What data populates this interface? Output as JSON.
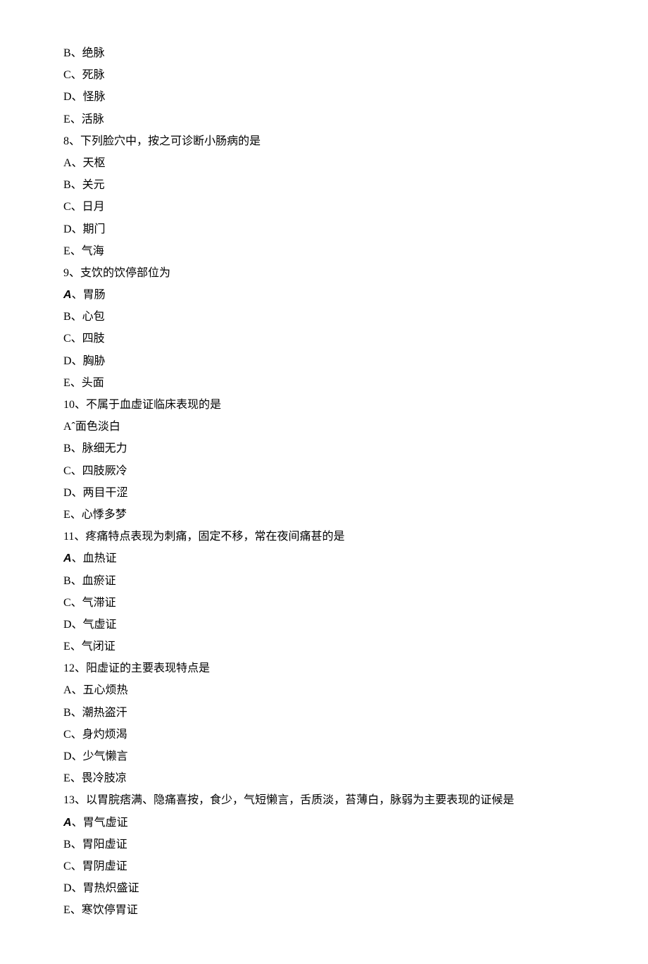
{
  "lines": [
    {
      "text": "B、绝脉",
      "italic": false
    },
    {
      "text": "C、死脉",
      "italic": false
    },
    {
      "text": "D、怪脉",
      "italic": false
    },
    {
      "text": "E、活脉",
      "italic": false
    },
    {
      "text": "8、下列脸穴中，按之可诊断小肠病的是",
      "italic": false
    },
    {
      "text": "A、天枢",
      "italic": false
    },
    {
      "text": "B、关元",
      "italic": false
    },
    {
      "text": "C、日月",
      "italic": false
    },
    {
      "text": "D、期门",
      "italic": false
    },
    {
      "text": "E、气海",
      "italic": false
    },
    {
      "text": "9、支饮的饮停部位为",
      "italic": false
    },
    {
      "prefix": "A",
      "text": "、胃肠",
      "italic": true
    },
    {
      "text": "B、心包",
      "italic": false
    },
    {
      "text": "C、四肢",
      "italic": false
    },
    {
      "text": "D、胸胁",
      "italic": false
    },
    {
      "text": "E、头面",
      "italic": false
    },
    {
      "text": "10、不属于血虚证临床表现的是",
      "italic": false
    },
    {
      "text": "Aˆ面色淡白",
      "italic": false
    },
    {
      "text": "B、脉细无力",
      "italic": false
    },
    {
      "text": "C、四肢厥冷",
      "italic": false
    },
    {
      "text": "D、两目干涩",
      "italic": false
    },
    {
      "text": "E、心悸多梦",
      "italic": false
    },
    {
      "text": "11、疼痛特点表现为刺痛，固定不移，常在夜间痛甚的是",
      "italic": false
    },
    {
      "prefix": "A",
      "text": "、血热证",
      "italic": true
    },
    {
      "text": "B、血瘀证",
      "italic": false
    },
    {
      "text": "C、气滞证",
      "italic": false
    },
    {
      "text": "D、气虚证",
      "italic": false
    },
    {
      "text": "E、气闭证",
      "italic": false
    },
    {
      "text": "12、阳虚证的主要表现特点是",
      "italic": false
    },
    {
      "text": "A、五心烦热",
      "italic": false
    },
    {
      "text": "B、潮热盗汗",
      "italic": false
    },
    {
      "text": "C、身灼烦渴",
      "italic": false
    },
    {
      "text": "D、少气懒言",
      "italic": false
    },
    {
      "text": "E、畏冷肢凉",
      "italic": false
    },
    {
      "text": "13、以胃脘痞满、隐痛喜按，食少，气短懒言，舌质淡，苔薄白，脉弱为主要表现的证候是",
      "italic": false
    },
    {
      "prefix": "A",
      "text": "、胃气虚证",
      "italic": true
    },
    {
      "text": "B、胃阳虚证",
      "italic": false
    },
    {
      "text": "C、胃阴虚证",
      "italic": false
    },
    {
      "text": "D、胃热炽盛证",
      "italic": false
    },
    {
      "text": "E、寒饮停胃证",
      "italic": false
    }
  ]
}
